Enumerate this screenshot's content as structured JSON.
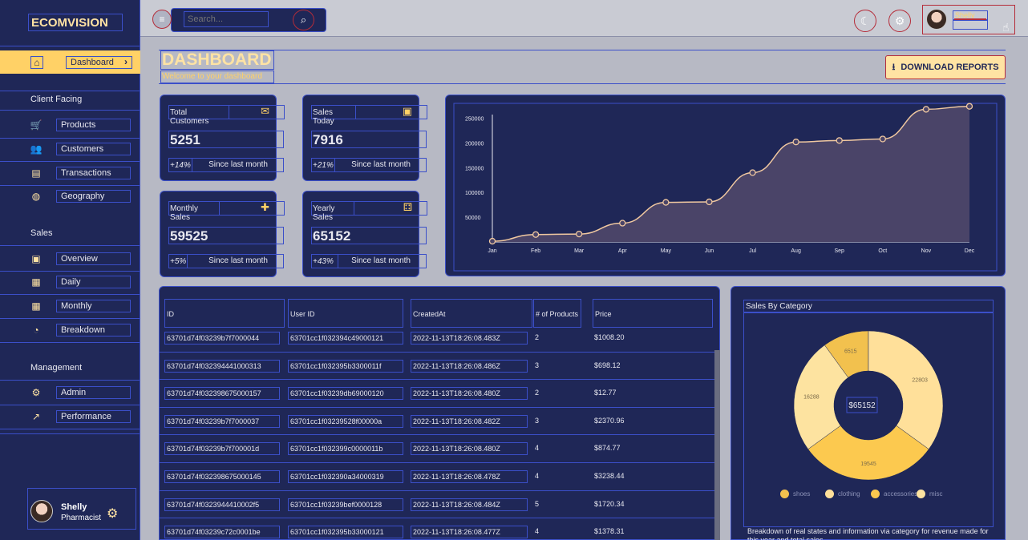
{
  "app": {
    "brand": "ECOMVISION"
  },
  "search": {
    "placeholder": "Search..."
  },
  "sidebar": {
    "active": {
      "label": "Dashboard"
    },
    "sections": {
      "client": "Client Facing",
      "sales": "Sales",
      "management": "Management"
    },
    "client_items": [
      {
        "label": "Products",
        "icon": "shopping-cart-icon"
      },
      {
        "label": "Customers",
        "icon": "groups-icon"
      },
      {
        "label": "Transactions",
        "icon": "receipt-icon"
      },
      {
        "label": "Geography",
        "icon": "globe-icon"
      }
    ],
    "sales_items": [
      {
        "label": "Overview",
        "icon": "point-of-sale-icon"
      },
      {
        "label": "Daily",
        "icon": "today-icon"
      },
      {
        "label": "Monthly",
        "icon": "calendar-month-icon"
      },
      {
        "label": "Breakdown",
        "icon": "pie-chart-icon"
      }
    ],
    "management_items": [
      {
        "label": "Admin",
        "icon": "admin-icon"
      },
      {
        "label": "Performance",
        "icon": "trending-up-icon"
      }
    ],
    "profile": {
      "name": "Shelly",
      "role": "Pharmacist"
    }
  },
  "topbar": {
    "user_name": "Shelly"
  },
  "header": {
    "title": "DASHBOARD",
    "subtitle": "Welcome to your dashboard",
    "download_label": "DOWNLOAD REPORTS"
  },
  "stats": [
    {
      "label": "Total Customers",
      "value": "5251",
      "pct": "+14%",
      "since": "Since last month",
      "icon": "email-icon"
    },
    {
      "label": "Sales Today",
      "value": "7916",
      "pct": "+21%",
      "since": "Since last month",
      "icon": "point-of-sale-icon"
    },
    {
      "label": "Monthly Sales",
      "value": "59525",
      "pct": "+5%",
      "since": "Since last month",
      "icon": "person-add-icon"
    },
    {
      "label": "Yearly Sales",
      "value": "65152",
      "pct": "+43%",
      "since": "Since last month",
      "icon": "traffic-icon"
    }
  ],
  "chart_data": {
    "type": "area",
    "x": [
      "Jan",
      "Feb",
      "Mar",
      "Apr",
      "May",
      "Jun",
      "Jul",
      "Aug",
      "Sep",
      "Oct",
      "Nov",
      "Dec"
    ],
    "values": [
      1500,
      15000,
      16000,
      38000,
      80000,
      81000,
      140000,
      202000,
      205000,
      208000,
      268000,
      274000
    ],
    "yticks": [
      "250000",
      "200000",
      "150000",
      "100000",
      "50000"
    ],
    "ylim": [
      0,
      280000
    ],
    "line_color": "#f0c8a0",
    "fill_color": "#4a4468"
  },
  "table": {
    "columns": [
      "ID",
      "User ID",
      "CreatedAt",
      "# of Products",
      "Price"
    ],
    "rows": [
      [
        "63701d74f03239b7f7000044",
        "63701cc1f032394c49000121",
        "2022-11-13T18:26:08.483Z",
        "2",
        "$1008.20"
      ],
      [
        "63701d74f032394441000313",
        "63701cc1f032395b3300011f",
        "2022-11-13T18:26:08.486Z",
        "3",
        "$698.12"
      ],
      [
        "63701d74f032398675000157",
        "63701cc1f03239db69000120",
        "2022-11-13T18:26:08.480Z",
        "2",
        "$12.77"
      ],
      [
        "63701d74f03239b7f7000037",
        "63701cc1f03239528f00000a",
        "2022-11-13T18:26:08.482Z",
        "3",
        "$2370.96"
      ],
      [
        "63701d74f03239b7f700001d",
        "63701cc1f032399c0000011b",
        "2022-11-13T18:26:08.480Z",
        "4",
        "$874.77"
      ],
      [
        "63701d74f032398675000145",
        "63701cc1f032390a34000319",
        "2022-11-13T18:26:08.478Z",
        "4",
        "$3238.44"
      ],
      [
        "63701d74f0323944410002f5",
        "63701cc1f03239bef0000128",
        "2022-11-13T18:26:08.484Z",
        "5",
        "$1720.34"
      ],
      [
        "63701d74f03239c72c0001be",
        "63701cc1f032395b33000121",
        "2022-11-13T18:26:08.477Z",
        "4",
        "$1378.31"
      ]
    ]
  },
  "pie": {
    "title": "Sales By Category",
    "center_label": "$65152",
    "description": "Breakdown of real states and information via category for revenue made for this year and total sales.",
    "slices": [
      {
        "name": "shoes",
        "value": 6515,
        "color": "#f2c14e"
      },
      {
        "name": "clothing",
        "value": 22803,
        "color": "#ffe09a"
      },
      {
        "name": "accessories",
        "value": 19545,
        "color": "#fcc94f"
      },
      {
        "name": "misc",
        "value": 16288,
        "color": "#fde3a0"
      }
    ],
    "labels": [
      "6515",
      "22803",
      "19545",
      "16288"
    ],
    "legend": [
      "shoes",
      "clothing",
      "accessories",
      "misc"
    ]
  }
}
